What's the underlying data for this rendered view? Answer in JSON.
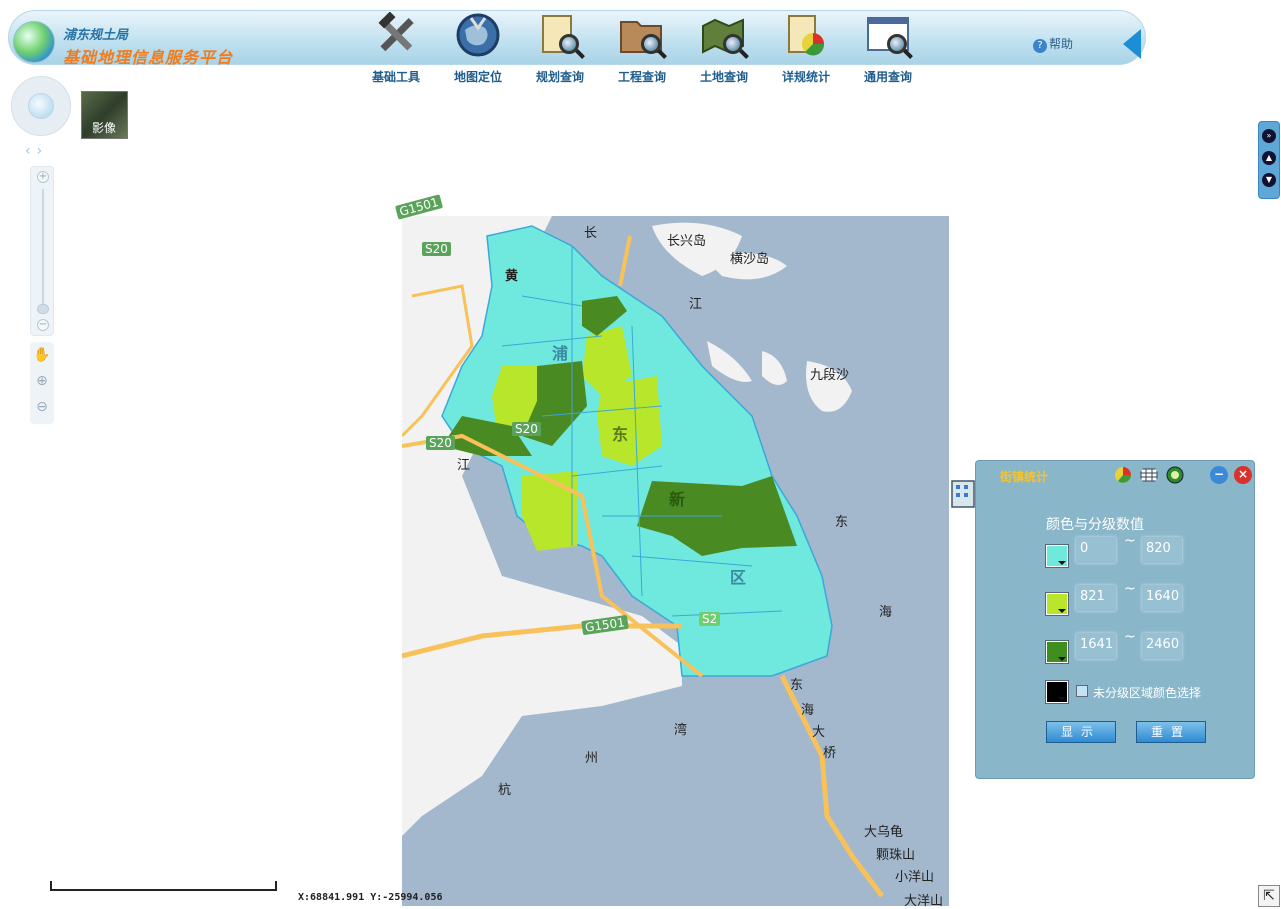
{
  "header": {
    "org_name": "浦东规土局",
    "platform_title": "基础地理信息服务平台",
    "help_label": "帮助"
  },
  "toolbar": {
    "items": [
      {
        "label": "基础工具",
        "icon": "tools-icon"
      },
      {
        "label": "地图定位",
        "icon": "globe-locate-icon"
      },
      {
        "label": "规划查询",
        "icon": "planning-search-icon"
      },
      {
        "label": "工程查询",
        "icon": "project-search-icon"
      },
      {
        "label": "土地查询",
        "icon": "land-search-icon"
      },
      {
        "label": "详规统计",
        "icon": "chart-statistics-icon"
      },
      {
        "label": "通用查询",
        "icon": "general-search-icon"
      }
    ]
  },
  "layer_switch": {
    "label": "影像"
  },
  "map": {
    "labels": [
      "长",
      "长兴岛",
      "横沙岛",
      "江",
      "九段沙",
      "黄",
      "浦",
      "东",
      "新",
      "区",
      "江",
      "东",
      "海",
      "东",
      "海",
      "大",
      "桥",
      "湾",
      "州",
      "杭",
      "大乌龟",
      "颗珠山",
      "小洋山",
      "大洋山",
      "G1501",
      "S20",
      "S20",
      "S20",
      "G1501",
      "S2"
    ],
    "colors": {
      "class1": "#6fe8de",
      "class2": "#b8e62a",
      "class3": "#4a8a22",
      "water": "#a3b8cc",
      "land": "#f2f2f2"
    }
  },
  "stats_panel": {
    "title": "街镇统计",
    "legend_title": "颜色与分级数值",
    "classes": [
      {
        "min": "0",
        "max": "820",
        "color": "#6fe8de"
      },
      {
        "min": "821",
        "max": "1640",
        "color": "#b8e62a"
      },
      {
        "min": "1641",
        "max": "2460",
        "color": "#3f8f1f"
      }
    ],
    "unclassified_color": "#000000",
    "unclassified_label": "未分级区域颜色选择",
    "show_button": "显示",
    "reset_button": "重置",
    "separator": "~"
  },
  "status": {
    "coords": "X:68841.991  Y:-25994.056"
  }
}
